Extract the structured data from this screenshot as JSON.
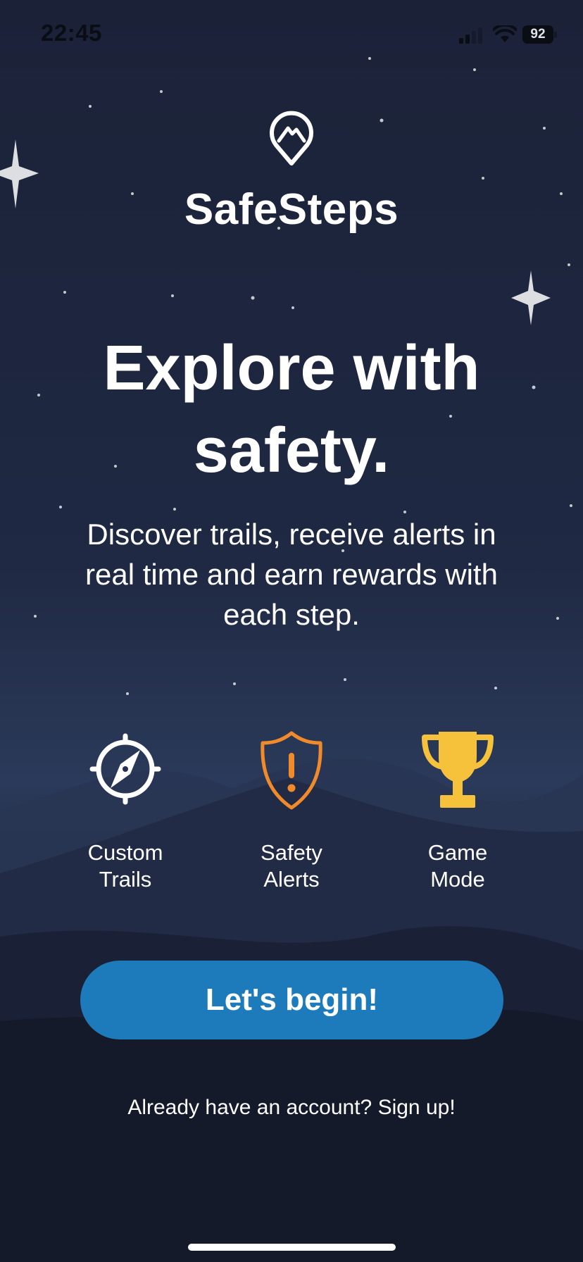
{
  "status_bar": {
    "time": "22:45",
    "battery": "92",
    "icons": [
      "signal-icon",
      "wifi-icon",
      "battery-icon"
    ]
  },
  "app": {
    "name": "SafeSteps",
    "logo_icon": "mountain-pin-icon"
  },
  "hero": {
    "headline_line1": "Explore with",
    "headline_line2": "safety.",
    "subtitle": "Discover trails, receive alerts in real time and earn rewards with each step."
  },
  "features": [
    {
      "icon": "compass-icon",
      "line1": "Custom",
      "line2": "Trails",
      "color": "#ffffff"
    },
    {
      "icon": "shield-alert-icon",
      "line1": "Safety",
      "line2": "Alerts",
      "color": "#f08a2a"
    },
    {
      "icon": "trophy-icon",
      "line1": "Game",
      "line2": "Mode",
      "color": "#f6c23c"
    }
  ],
  "cta": {
    "label": "Let's begin!",
    "color": "#1e7bbb"
  },
  "signup": {
    "text": "Already have an account? Sign up!"
  }
}
